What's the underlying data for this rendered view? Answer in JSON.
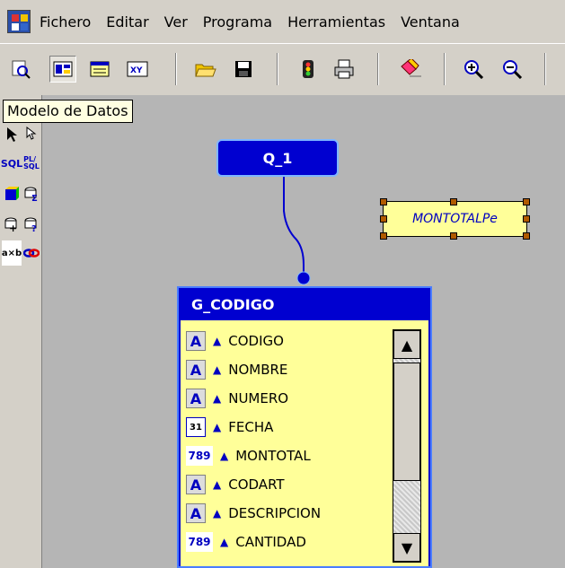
{
  "menu": {
    "items": [
      "Fichero",
      "Editar",
      "Ver",
      "Programa",
      "Herramientas",
      "Ventana"
    ]
  },
  "tooltip": {
    "text": "Modelo de Datos"
  },
  "palette": {
    "sql_label": "SQL",
    "plsql_label": "PL/\nSQL",
    "axb_label": "a×b"
  },
  "canvas": {
    "query_name": "Q_1",
    "formula_field": "MONTOTALPe",
    "group": {
      "title": "G_CODIGO",
      "columns": [
        {
          "name": "CODIGO",
          "type_icon": "A"
        },
        {
          "name": "NOMBRE",
          "type_icon": "A"
        },
        {
          "name": "NUMERO",
          "type_icon": "A"
        },
        {
          "name": "FECHA",
          "type_icon": "31"
        },
        {
          "name": "MONTOTAL",
          "type_icon": "789"
        },
        {
          "name": "CODART",
          "type_icon": "A"
        },
        {
          "name": "DESCRIPCION",
          "type_icon": "A"
        },
        {
          "name": "CANTIDAD",
          "type_icon": "789"
        }
      ]
    }
  },
  "colors": {
    "window_bg": "#d4d0c8",
    "canvas_bg": "#b5b5b5",
    "object_blue": "#0000d0",
    "field_yellow": "#ffff99"
  }
}
